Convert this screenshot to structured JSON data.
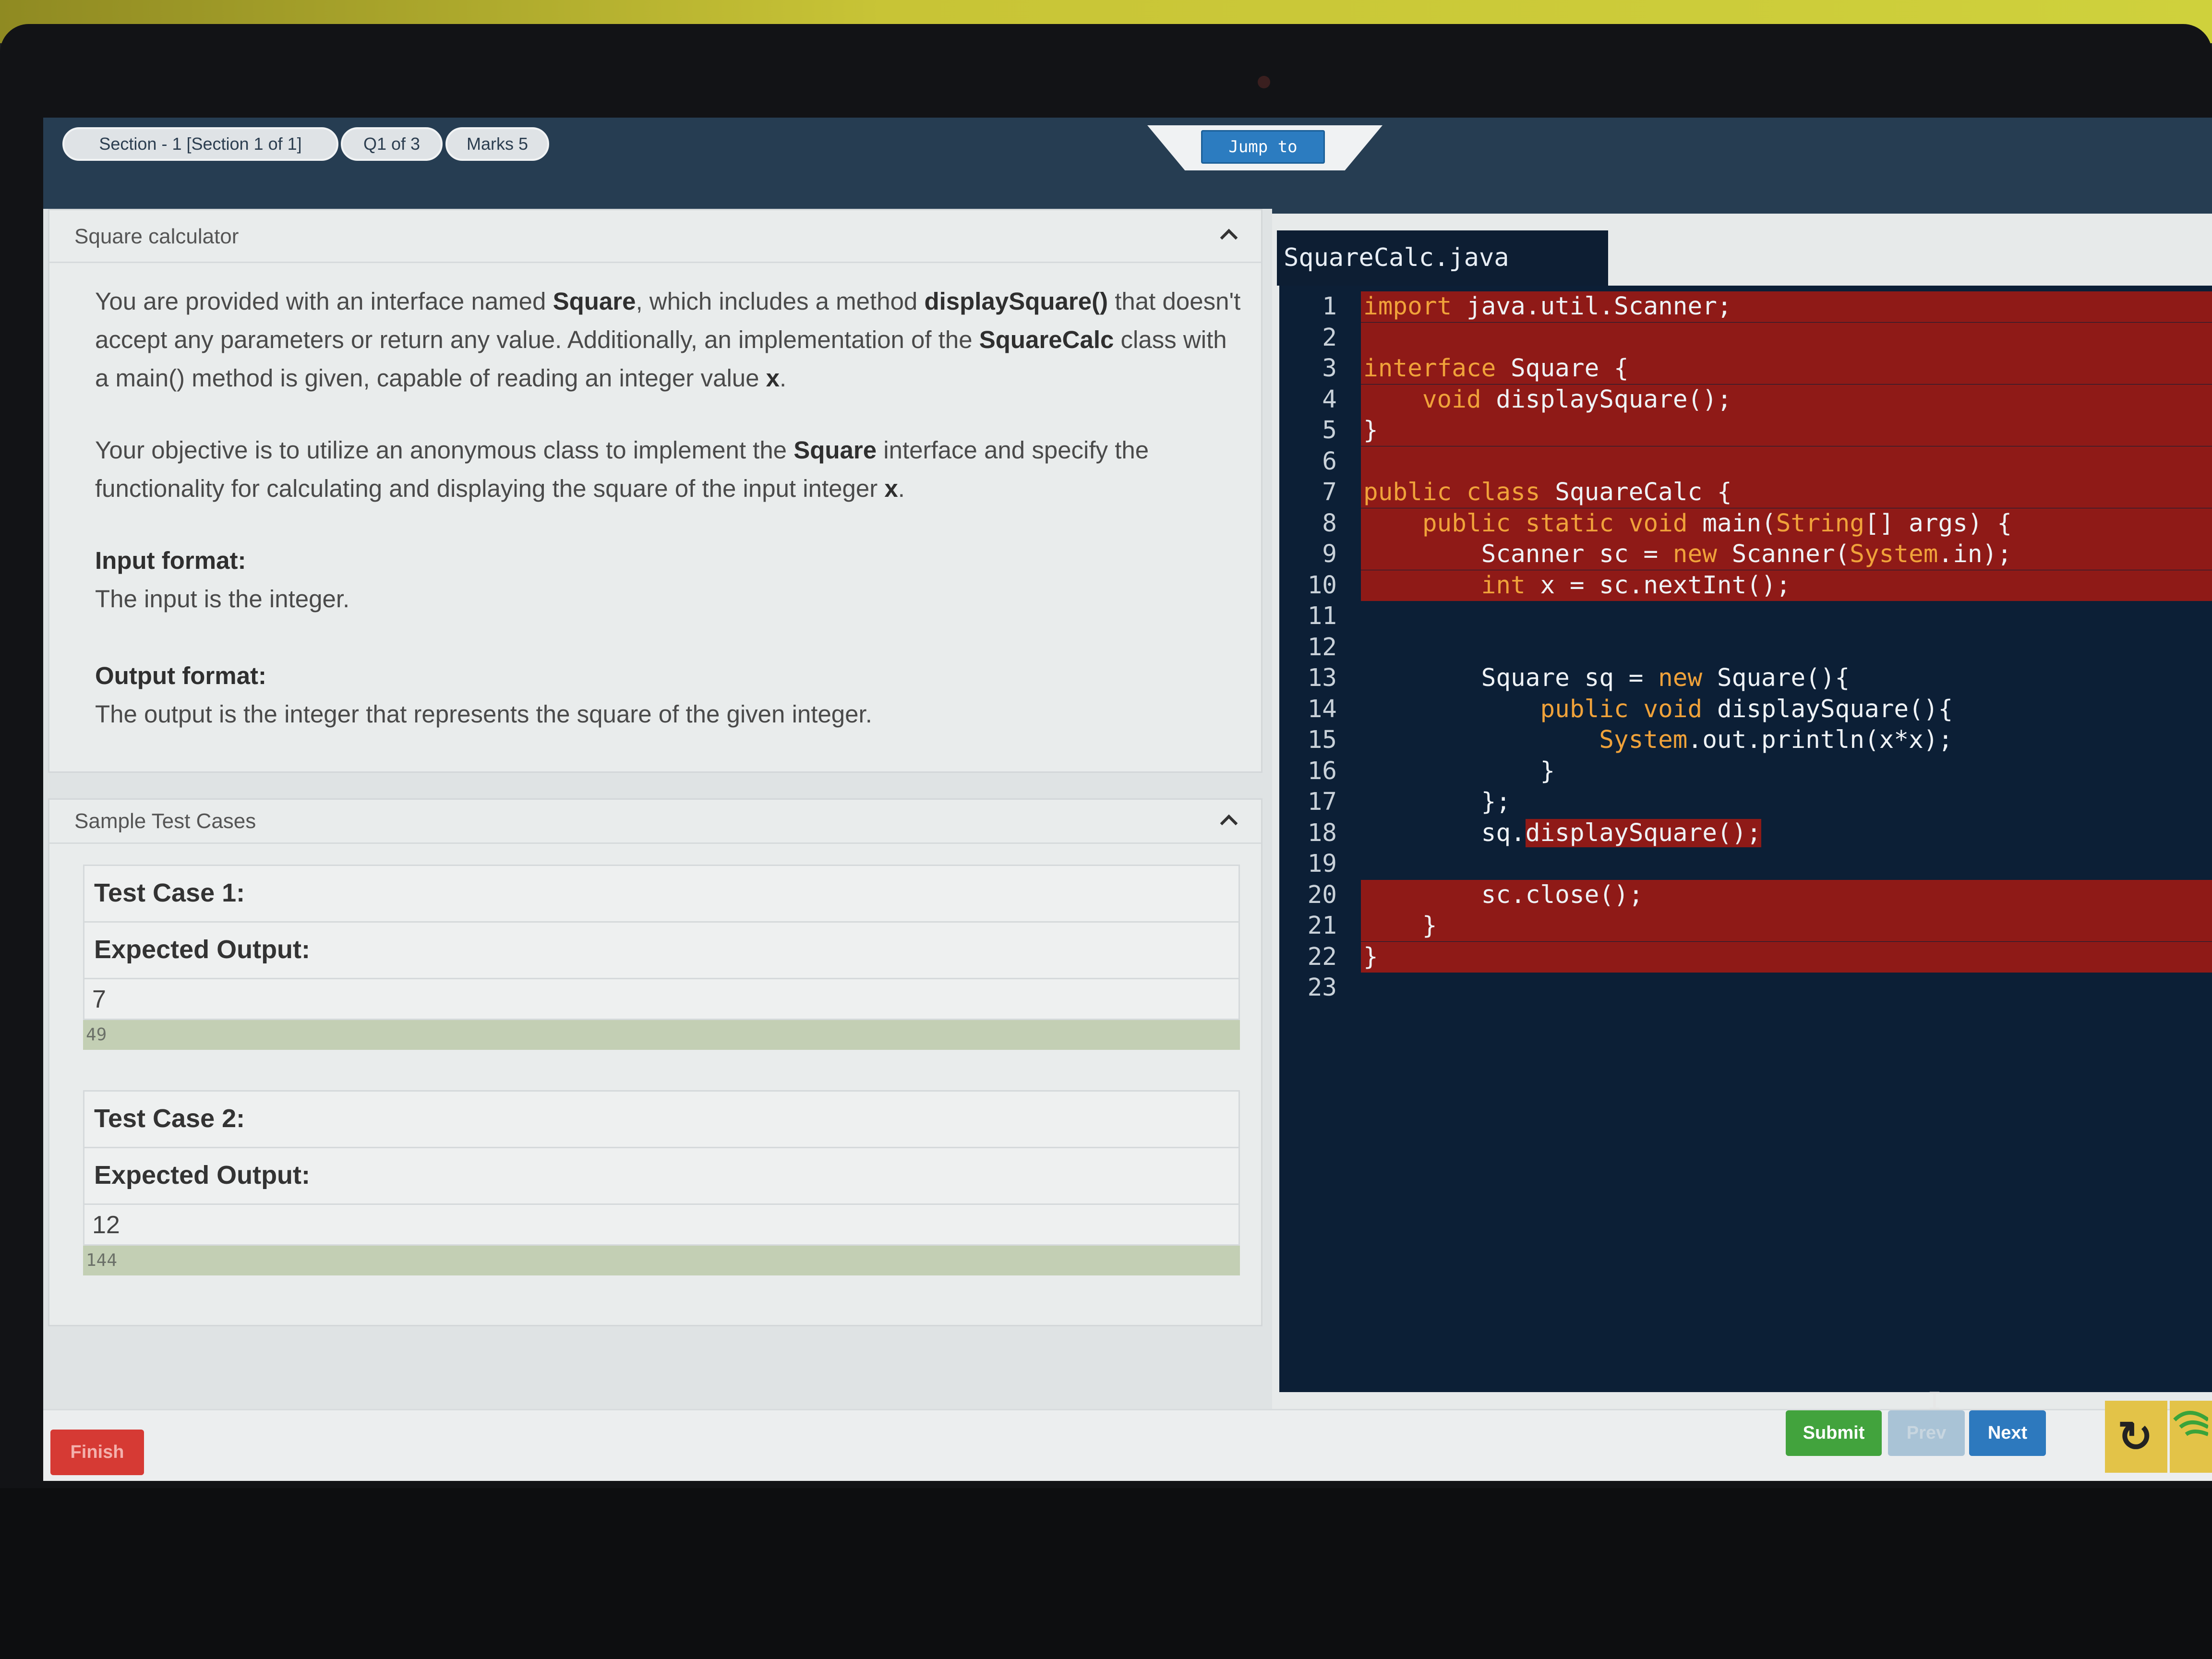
{
  "header": {
    "section_pill": "Section - 1 [Section 1 of 1]",
    "question_pill": "Q1 of 3",
    "marks_pill": "Marks 5",
    "jump_label": "Jump to"
  },
  "question": {
    "card_title": "Square calculator",
    "para1_a": "You are provided with an interface named ",
    "para1_b": "Square",
    "para1_c": ", which includes a method ",
    "para1_d": "displaySquare()",
    "para1_e": " that doesn't accept any parameters or return any value. Additionally, an implementation of the ",
    "para1_f": "SquareCalc",
    "para1_g": " class with a main() method is given, capable of reading an integer value ",
    "para1_h": "x",
    "para1_i": ".",
    "para2_a": "Your objective is to utilize an anonymous class to implement the ",
    "para2_b": "Square",
    "para2_c": " interface and specify the functionality for calculating and displaying the square of the input integer ",
    "para2_d": "x",
    "para2_e": ".",
    "input_title": "Input format:",
    "input_text": "The input is the integer.",
    "output_title": "Output format:",
    "output_text": "The output is the integer that represents the square of the given integer."
  },
  "tests": {
    "card_title": "Sample Test Cases",
    "cases": [
      {
        "title": "Test Case 1:",
        "expected_label": "Expected Output:",
        "input": "7",
        "output": "49"
      },
      {
        "title": "Test Case 2:",
        "expected_label": "Expected Output:",
        "input": "12",
        "output": "144"
      }
    ]
  },
  "editor": {
    "filename": "SquareCalc.java",
    "lines": [
      "import java.util.Scanner;",
      "",
      "interface Square {",
      "    void displaySquare();",
      "}",
      "",
      "public class SquareCalc {",
      "    public static void main(String[] args) {",
      "        Scanner sc = new Scanner(System.in);",
      "        int x = sc.nextInt();",
      "",
      "",
      "        Square sq = new Square(){",
      "            public void displaySquare(){",
      "                System.out.println(x*x);",
      "            }",
      "        };",
      "        sq.displaySquare();",
      "",
      "        sc.close();",
      "    }",
      "}",
      ""
    ],
    "error_lines": [
      1,
      2,
      3,
      4,
      5,
      6,
      7,
      8,
      9,
      10,
      20,
      21,
      22
    ]
  },
  "footer": {
    "finish_label": "Finish",
    "submit_label": "Submit",
    "prev_label": "Prev",
    "next_label": "Next",
    "refresh_icon": "refresh-icon",
    "wifi_icon": "wifi-icon"
  },
  "colors": {
    "error_highlight": "#8f1a17",
    "editor_bg": "#0c1f36",
    "submit": "#42a33d",
    "next": "#2d79be",
    "finish": "#d63a34"
  }
}
